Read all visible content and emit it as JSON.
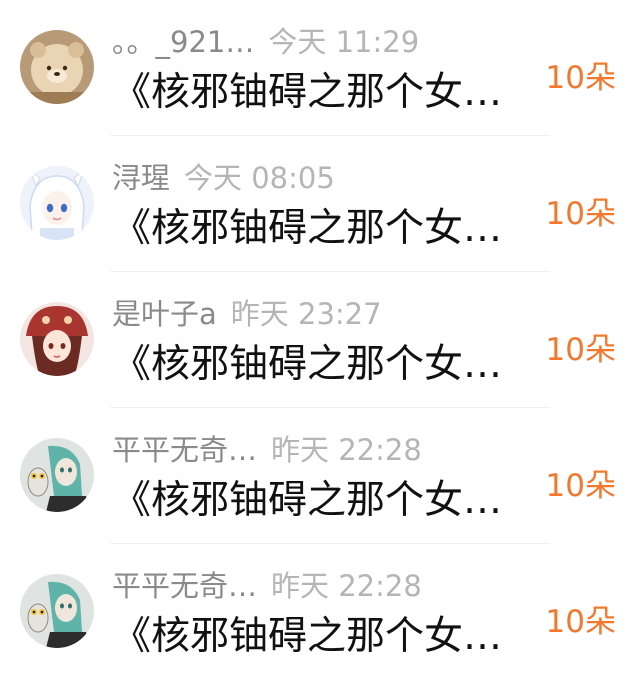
{
  "rows": [
    {
      "name": "。。_921…",
      "time": "今天 11:29",
      "message": "《核邪铀碍之那个女…",
      "count": "10朵",
      "avatar_icon": "bear-hat-avatar-icon"
    },
    {
      "name": "浔瑆",
      "time": "今天 08:05",
      "message": "《核邪铀碍之那个女…",
      "count": "10朵",
      "avatar_icon": "anime-girl-avatar-icon"
    },
    {
      "name": "是叶子a",
      "time": "昨天 23:27",
      "message": "《核邪铀碍之那个女…",
      "count": "10朵",
      "avatar_icon": "red-hat-girl-avatar-icon"
    },
    {
      "name": "平平无奇…",
      "time": "昨天 22:28",
      "message": "《核邪铀碍之那个女…",
      "count": "10朵",
      "avatar_icon": "green-hair-owl-avatar-icon"
    },
    {
      "name": "平平无奇…",
      "time": "昨天 22:28",
      "message": "《核邪铀碍之那个女…",
      "count": "10朵",
      "avatar_icon": "green-hair-owl-avatar-icon"
    }
  ],
  "colors": {
    "count": "#f1782d",
    "name": "#8a8a8a",
    "time": "#b5b5b5",
    "message": "#111111"
  }
}
